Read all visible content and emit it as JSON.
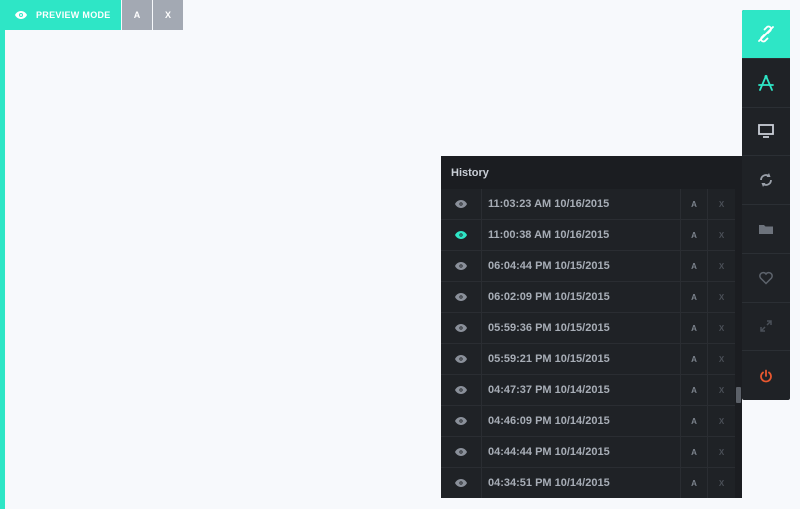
{
  "preview_bar": {
    "label": "PREVIEW MODE",
    "a_label": "A",
    "x_label": "X"
  },
  "toolbar": {
    "tools": [
      {
        "icon": "unlink-icon",
        "active": true
      },
      {
        "icon": "compass-icon",
        "active": false
      },
      {
        "icon": "monitor-icon",
        "active": false
      },
      {
        "icon": "sync-icon",
        "active": false
      },
      {
        "icon": "folder-icon",
        "active": false
      },
      {
        "icon": "heart-icon",
        "active": false
      },
      {
        "icon": "expand-icon",
        "active": false
      },
      {
        "icon": "power-icon",
        "active": false
      }
    ]
  },
  "history": {
    "title": "History",
    "rows": [
      {
        "time": "11:03:23 AM 10/16/2015",
        "a": "A",
        "x": "X",
        "current": false
      },
      {
        "time": "11:00:38 AM 10/16/2015",
        "a": "A",
        "x": "X",
        "current": true
      },
      {
        "time": "06:04:44 PM 10/15/2015",
        "a": "A",
        "x": "X",
        "current": false
      },
      {
        "time": "06:02:09 PM 10/15/2015",
        "a": "A",
        "x": "X",
        "current": false
      },
      {
        "time": "05:59:36 PM 10/15/2015",
        "a": "A",
        "x": "X",
        "current": false
      },
      {
        "time": "05:59:21 PM 10/15/2015",
        "a": "A",
        "x": "X",
        "current": false
      },
      {
        "time": "04:47:37 PM 10/14/2015",
        "a": "A",
        "x": "X",
        "current": false
      },
      {
        "time": "04:46:09 PM 10/14/2015",
        "a": "A",
        "x": "X",
        "current": false
      },
      {
        "time": "04:44:44 PM 10/14/2015",
        "a": "A",
        "x": "X",
        "current": false
      },
      {
        "time": "04:34:51 PM 10/14/2015",
        "a": "A",
        "x": "X",
        "current": false
      }
    ]
  },
  "colors": {
    "accent": "#2ee6c6",
    "power": "#e8572f",
    "panel": "#1f2226"
  }
}
